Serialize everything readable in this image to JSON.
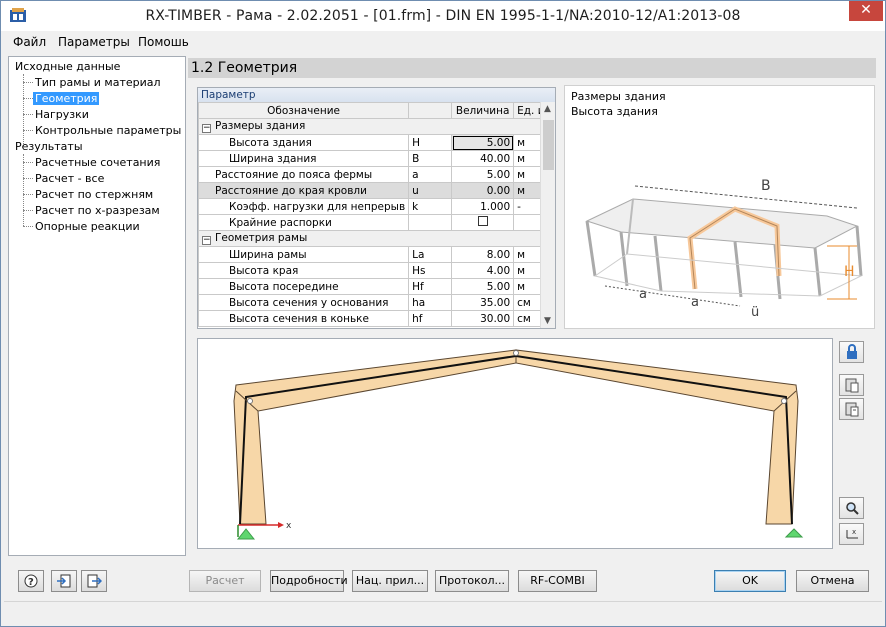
{
  "window": {
    "title": "RX-TIMBER - Рама - 2.02.2051 - [01.frm] - DIN EN 1995-1-1/NA:2010-12/A1:2013-08",
    "close_glyph": "✕"
  },
  "menu": [
    "Файл",
    "Параметры",
    "Помошь"
  ],
  "navigator": {
    "input_root": "Исходные данные",
    "input_items": [
      "Тип рамы и материал",
      "Геометрия",
      "Нагрузки",
      "Контрольные параметры"
    ],
    "selected": "Геометрия",
    "results_root": "Результаты",
    "results_items": [
      "Расчетные сочетания",
      "Расчет - все",
      "Расчет по стержням",
      "Расчет по x-разрезам",
      "Опорные реакции"
    ]
  },
  "section": {
    "title": "1.2 Геометрия"
  },
  "params": {
    "panel_title": "Параметр",
    "columns": {
      "name": "Обозначение",
      "symbol": "",
      "value": "Величина",
      "unit": "Ед. из"
    },
    "groups": [
      {
        "label": "Размеры здания",
        "expander": "−",
        "rows": [
          {
            "name": "Высота здания",
            "symbol": "H",
            "value": "5.00",
            "unit": "м"
          },
          {
            "name": "Ширина здания",
            "symbol": "B",
            "value": "40.00",
            "unit": "м"
          },
          {
            "name": "Расстояние до пояса фермы",
            "symbol": "a",
            "value": "5.00",
            "unit": "м"
          },
          {
            "name": "Расстояние до края кровли",
            "symbol": "u",
            "value": "0.00",
            "unit": "м"
          },
          {
            "name": "Коэфф. нагрузки для непрерыв",
            "symbol": "k",
            "value": "1.000",
            "unit": "-"
          },
          {
            "name": "Крайние распорки",
            "symbol": "",
            "value": "",
            "unit": "",
            "checkbox": true
          }
        ]
      },
      {
        "label": "Геометрия рамы",
        "expander": "−",
        "rows": [
          {
            "name": "Ширина рамы",
            "symbol": "La",
            "value": "8.00",
            "unit": "м"
          },
          {
            "name": "Высота края",
            "symbol": "Hs",
            "value": "4.00",
            "unit": "м"
          },
          {
            "name": "Высота посередине",
            "symbol": "Hf",
            "value": "5.00",
            "unit": "м"
          },
          {
            "name": "Высота сечения у основания",
            "symbol": "ha",
            "value": "35.00",
            "unit": "см"
          },
          {
            "name": "Высота сечения в коньке",
            "symbol": "hf",
            "value": "30.00",
            "unit": "см"
          }
        ]
      }
    ]
  },
  "preview": {
    "line1": "Размеры здания",
    "line2": "Высота здания",
    "labels": {
      "B": "B",
      "H": "H",
      "a1": "a",
      "a2": "a",
      "u": "ü"
    }
  },
  "frame": {
    "axis_label": "x"
  },
  "buttons": {
    "calc": "Расчет",
    "details": "Подробности",
    "national": "Нац. прил...",
    "protocol": "Протокол...",
    "rfcombi": "RF-COMBI",
    "ok": "OK",
    "cancel": "Отмена"
  },
  "colors": {
    "accent": "#3399ff",
    "timber": "#f7d7a8",
    "support": "#5fd66f",
    "dimension_orange": "#e88b2e"
  }
}
